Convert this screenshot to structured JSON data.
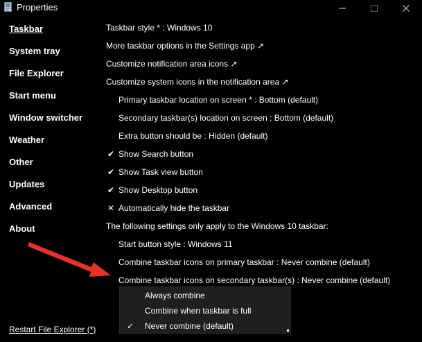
{
  "window": {
    "title": "Properties",
    "icons": {
      "app": "properties-app-icon",
      "minimize": "minimize-icon",
      "maximize": "maximize-icon",
      "close": "close-icon"
    }
  },
  "sidebar": {
    "items": [
      {
        "label": "Taskbar",
        "active": true
      },
      {
        "label": "System tray"
      },
      {
        "label": "File Explorer"
      },
      {
        "label": "Start menu"
      },
      {
        "label": "Window switcher"
      },
      {
        "label": "Weather"
      },
      {
        "label": "Other"
      },
      {
        "label": "Updates"
      },
      {
        "label": "Advanced"
      },
      {
        "label": "About"
      }
    ],
    "restart_link": "Restart File Explorer (*)"
  },
  "settings": {
    "taskbar_style": "Taskbar style * : Windows 10",
    "more_options": "More taskbar options in the Settings app ↗",
    "customize_notification": "Customize notification area icons ↗",
    "customize_system_icons": "Customize system icons in the notification area ↗",
    "primary_location": "Primary taskbar location on screen * : Bottom (default)",
    "secondary_location": "Secondary taskbar(s) location on screen : Bottom (default)",
    "extra_button": "Extra button should be : Hidden (default)",
    "show_search": {
      "mark": "✔",
      "label": "Show Search button",
      "checked": true
    },
    "show_task_view": {
      "mark": "✔",
      "label": "Show Task view button",
      "checked": true
    },
    "show_desktop": {
      "mark": "✔",
      "label": "Show Desktop button",
      "checked": true
    },
    "auto_hide": {
      "mark": "✕",
      "label": "Automatically hide the taskbar",
      "checked": false
    },
    "win10_note": "The following settings only apply to the Windows 10 taskbar:",
    "start_button_style": "Start button style : Windows 11",
    "combine_primary": "Combine taskbar icons on primary taskbar : Never combine (default)",
    "combine_secondary": "Combine taskbar icons on secondary taskbar(s) : Never combine (default)"
  },
  "dropdown": {
    "options": [
      {
        "label": "Always combine",
        "selected": false
      },
      {
        "label": "Combine when taskbar is full",
        "selected": false
      },
      {
        "label": "Never combine (default)",
        "selected": true
      }
    ],
    "check_mark": "✓"
  },
  "annotation": {
    "arrow_color": "#e8312a"
  },
  "colors": {
    "background": "#000000",
    "text": "#ffffff",
    "dropdown_bg": "#1f1f1f"
  }
}
